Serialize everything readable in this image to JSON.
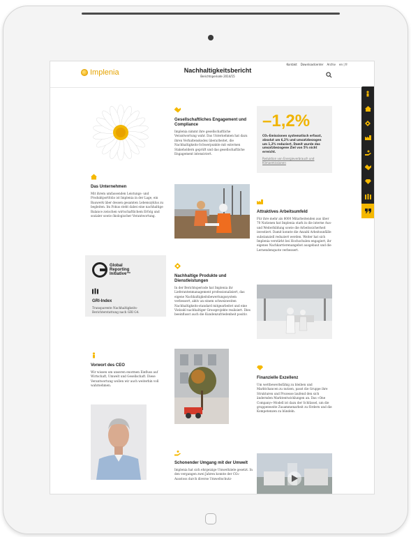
{
  "header": {
    "logo_text": "Implenia",
    "title": "Nachhaltigkeitsbericht",
    "subtitle": "Berichtsperiode 2014/15",
    "nav": [
      "Kontakt",
      "Downloadcenter",
      "Archiv",
      "en | fr"
    ]
  },
  "sidebar": {
    "icons": [
      "person-icon",
      "house-icon",
      "leaf-icon",
      "factory-icon",
      "hand-icon",
      "handshake-icon",
      "diamond-icon",
      "columns-icon",
      "quote-icon"
    ],
    "active_index": 8
  },
  "sections": {
    "unternehmen": {
      "title": "Das Unternehmen",
      "text": "Mit ihrem umfassenden Leistungs- und Produktportfolio ist Implenia in der Lage, ein Bauwerk über dessen gesamten Lebenszyklus zu begleiten. Im Fokus steht dabei eine nachhaltige Balance zwischen wirtschaftlichem Erfolg und sozialer sowie ökologischer Verantwortung."
    },
    "gri": {
      "logo_line1": "Global",
      "logo_line2": "Reporting",
      "logo_line3": "Initiative™",
      "title": "GRI-Index",
      "text": "Transparente Nachhaltigkeits-Berichterstattung nach GRI G4."
    },
    "ceo": {
      "title": "Vorwort des CEO",
      "text": "Wir wissen um unseren enormen Einfluss auf Wirtschaft, Umwelt und Gesellschaft. Diese Verantwortung wollen wir auch weiterhin voll wahrnehmen."
    },
    "engagement": {
      "title": "Gesellschaftliches Engagement und Compliance",
      "text": "Implenia nimmt ihre gesellschaftliche Verantwortung wahr. Das Unternehmen hat dazu ihren Verhaltenskodex überarbeitet, die Nachhaltigkeits-Schwerpunkte mit externen Stakeholdern geprüft und das gesellschaftliche Engagement intensiviert."
    },
    "produkte": {
      "title": "Nachhaltige Produkte und Dienstleistungen",
      "text": "In der Berichtsperiode hat Implenia ihr Lieferantenmanagement professionalisiert, das eigene Nachhaltigkeitsbewertungssystem verbessert, aktiv an einem schweizweiten Nachhaltigkeits-standard mitgearbeitet und eine Vielzahl nachhaltiger Grossprojekte realisiert. Dies beeinflusst auch die Kundenzufriedenheit positiv."
    },
    "umwelt": {
      "title": "Schonender Umgang mit der Umwelt",
      "text": "Implenia hat sich ehrgeizige Umweltziele gesetzt. In den vergangen zwei Jahren konnte der CO₂-Ausstoss durch diverse Umweltschutz-"
    },
    "kpi": {
      "value": "–1,2%",
      "text": "CO₂-Emissionen systematisch erfasst, absolut um 6,2% und umsatzbezogen um 1,2% reduziert. Damit wurde das umsatzbezogene Ziel von 5% nicht erreicht.",
      "link": "Reduktion von Energieverbrauch und Klimaemissionen"
    },
    "arbeitsumfeld": {
      "title": "Attraktives Arbeitsumfeld",
      "text": "Für ihre mehr als 8000 Mitarbeitenden aus über 70 Nationen hat Implenia stark in die interne Aus- und Weiterbildung sowie die Arbeitssicherheit investiert. Damit konnte die Anzahl Arbeitsunfälle substanziell reduziert werden. Weiter hat sich Implenia verstärkt bei Hochschulen engagiert, ihr eigenes Nachkarrierenangebot ausgebaut und die Lernendenquote verbessert."
    },
    "exzellenz": {
      "title": "Finanzielle Exzellenz",
      "text": "Um wettbewerbsfähig zu bleiben und Marktchancen zu nutzen, passt die Gruppe ihre Strukturen und Prozesse laufend den sich ändernden Marktentwicklungen an. Das «One Company»-Modell ist dazu der Schlüssel, um die gruppenweite Zusammenarbeit zu fördern und die Kompetenzen zu bündeln."
    }
  },
  "colors": {
    "accent": "#f5b800",
    "sidebar": "#222222"
  }
}
